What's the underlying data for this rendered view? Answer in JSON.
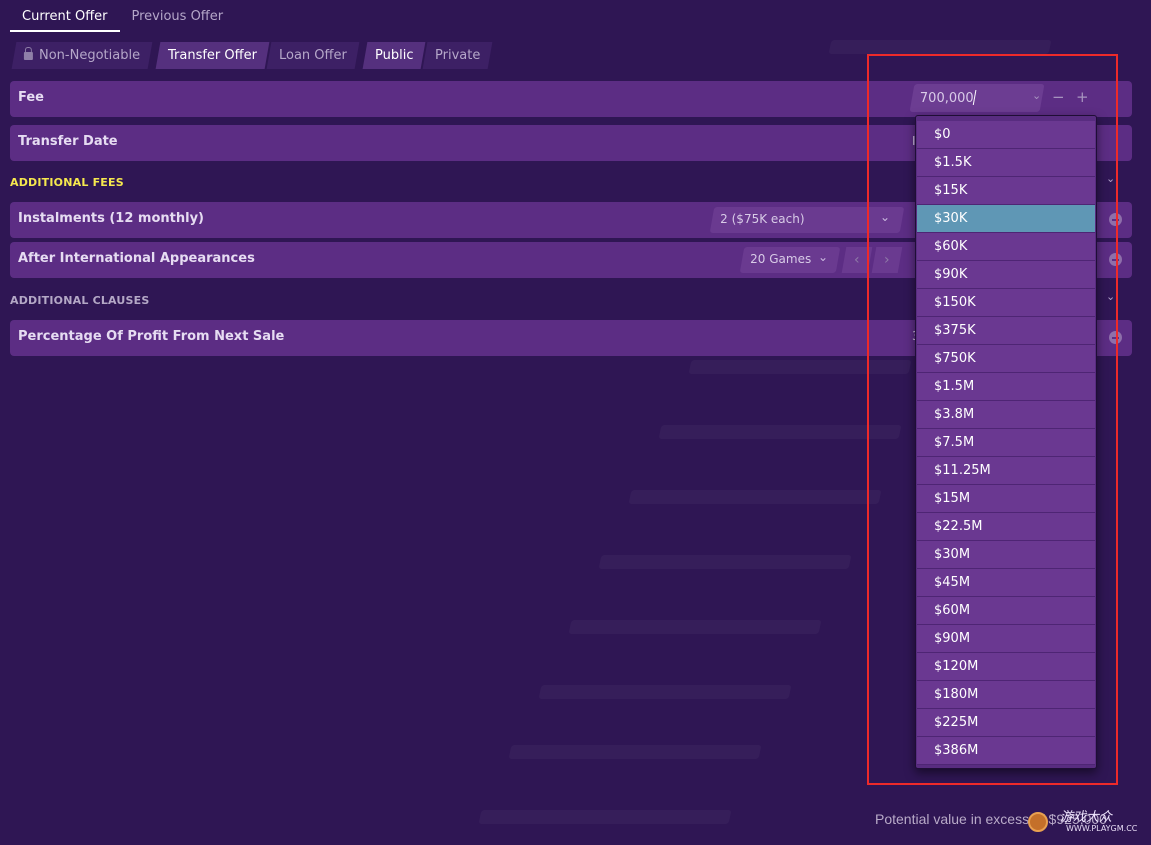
{
  "tabs": [
    {
      "label": "Current Offer",
      "active": true
    },
    {
      "label": "Previous Offer",
      "active": false
    }
  ],
  "toggles": {
    "negotiable": "Non-Negotiable",
    "offer_type": [
      "Transfer Offer",
      "Loan Offer"
    ],
    "visibility": [
      "Public",
      "Private"
    ]
  },
  "fee": {
    "label": "Fee",
    "value": "700,000",
    "minus": "−",
    "plus": "+"
  },
  "transfer_date": {
    "label": "Transfer Date",
    "value_partial": "I"
  },
  "additional_fees": {
    "heading": "ADDITIONAL FEES",
    "instalments": {
      "label": "Instalments (12 monthly)",
      "value": "2 ($75K each)"
    },
    "intl_apps": {
      "label": "After International Appearances",
      "value": "20 Games"
    }
  },
  "additional_clauses": {
    "heading": "ADDITIONAL CLAUSES",
    "profit": {
      "label": "Percentage Of Profit From Next Sale",
      "value_partial": "3"
    }
  },
  "dropdown": {
    "selected": "$30K",
    "options": [
      "$0",
      "$1.5K",
      "$15K",
      "$30K",
      "$60K",
      "$90K",
      "$150K",
      "$375K",
      "$750K",
      "$1.5M",
      "$3.8M",
      "$7.5M",
      "$11.25M",
      "$15M",
      "$22.5M",
      "$30M",
      "$45M",
      "$60M",
      "$90M",
      "$120M",
      "$180M",
      "$225M",
      "$386M"
    ]
  },
  "footer": {
    "potential_value": "Potential value in excess of $925,000"
  },
  "watermark": {
    "text": "游戏大众",
    "url": "WWW.PLAYGM.CC"
  },
  "colors": {
    "background": "#2f1654",
    "row": "#5c2d84",
    "selected": "#5f97b5",
    "highlight": "#ee2a2a",
    "section_yellow": "#f6e84e"
  }
}
